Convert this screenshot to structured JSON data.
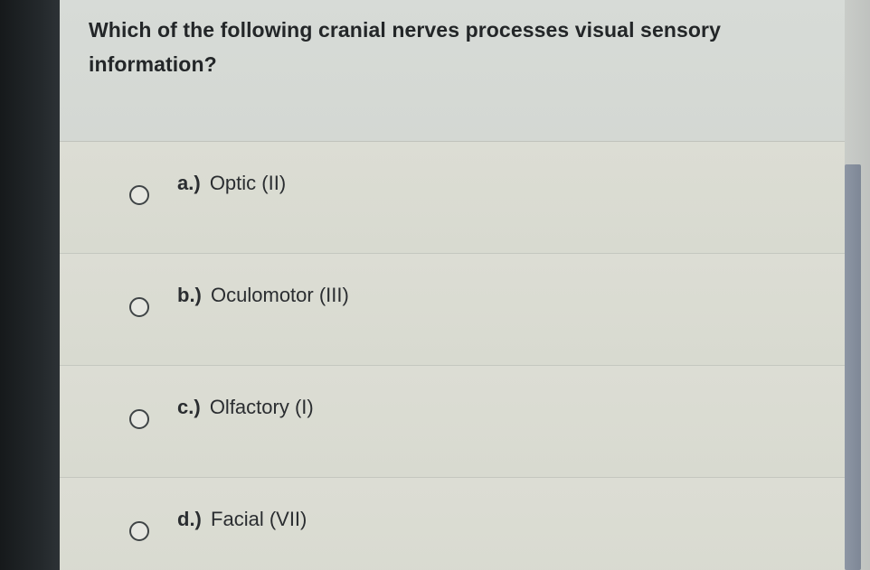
{
  "question": {
    "text": "Which of the following cranial nerves processes visual sensory information?"
  },
  "options": [
    {
      "letter": "a.)",
      "text": "Optic (II)"
    },
    {
      "letter": "b.)",
      "text": "Oculomotor (III)"
    },
    {
      "letter": "c.)",
      "text": "Olfactory (I)"
    },
    {
      "letter": "d.)",
      "text": "Facial (VII)"
    }
  ],
  "selected_option": null,
  "colors": {
    "panel_background": "#d8dad0",
    "question_text": "#232628",
    "scrollbar_thumb": "#8d96a4"
  }
}
